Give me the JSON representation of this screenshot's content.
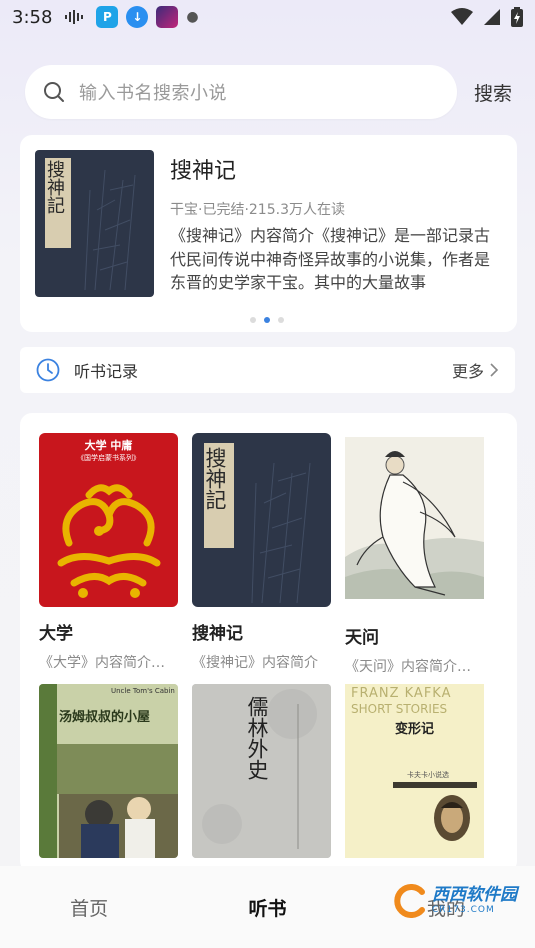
{
  "status_bar": {
    "time": "3:58"
  },
  "search": {
    "placeholder": "输入书名搜索小说",
    "button_label": "搜索"
  },
  "featured": {
    "title": "搜神记",
    "meta": "干宝·已完结·215.3万人在读",
    "description": "《搜神记》内容简介《搜神记》是一部记录古代民间传说中神奇怪异故事的小说集，作者是东晋的史学家干宝。其中的大量故事",
    "cover_text": "搜神記",
    "active_dot": 1
  },
  "history": {
    "label": "听书记录",
    "more_label": "更多"
  },
  "books": [
    {
      "title": "大学",
      "desc": "《大学》内容简介《大学》",
      "cover_top": "大学 中庸",
      "cover_sub": "《国学启蒙书系列》"
    },
    {
      "title": "搜神记",
      "desc": "《搜神记》内容简介",
      "cover_text": "搜神記"
    },
    {
      "title": "天问",
      "desc": "《天问》内容简介《天问》"
    },
    {
      "title": "",
      "desc": "",
      "cover_text": "汤姆叔叔的小屋",
      "cover_sub": "Uncle Tom's Cabin"
    },
    {
      "title": "",
      "desc": "",
      "cover_text": "儒林外史"
    },
    {
      "title": "",
      "desc": "",
      "cover_top": "FRANZ KAFKA",
      "cover_sub": "SHORT STORIES",
      "cover_text": "变形记",
      "cover_small": "卡夫卡小说选"
    }
  ],
  "nav": {
    "home": "首页",
    "listen": "听书",
    "mine": "我的"
  },
  "watermark": {
    "name": "西西软件园",
    "domain": "CR173.COM"
  },
  "colors": {
    "accent": "#3b82e0",
    "book_red": "#c8161d",
    "book_gold": "#e9b400",
    "book_navy": "#2d3648"
  }
}
